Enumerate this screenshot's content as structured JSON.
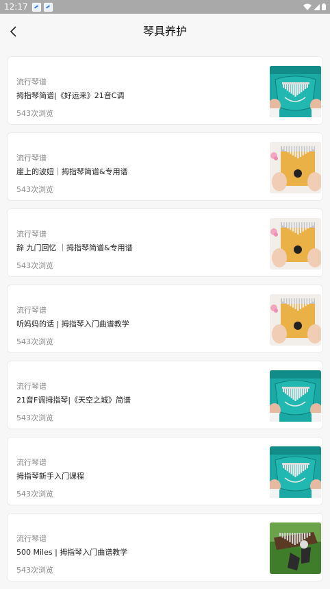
{
  "status_bar": {
    "time": "12:17"
  },
  "header": {
    "title": "琴具养护"
  },
  "items": [
    {
      "category": "流行琴谱",
      "title": "拇指琴简谱|《好运来》21音C调",
      "views": "543次浏览",
      "thumb_icon": "kalimba-teal-thumbnail"
    },
    {
      "category": "流行琴谱",
      "title": "崖上的波妞｜拇指琴简谱&专用谱",
      "views": "543次浏览",
      "thumb_icon": "kalimba-yellow-thumbnail"
    },
    {
      "category": "流行琴谱",
      "title": "辞 九门回忆 ｜拇指琴简谱&专用谱",
      "views": "543次浏览",
      "thumb_icon": "kalimba-yellow-thumbnail"
    },
    {
      "category": "流行琴谱",
      "title": "听妈妈的话 | 拇指琴入门曲谱教学",
      "views": "543次浏览",
      "thumb_icon": "kalimba-yellow-thumbnail"
    },
    {
      "category": "流行琴谱",
      "title": "21音F调拇指琴|《天空之城》简谱",
      "views": "543次浏览",
      "thumb_icon": "kalimba-teal-thumbnail"
    },
    {
      "category": "流行琴谱",
      "title": "拇指琴新手入门课程",
      "views": "543次浏览",
      "thumb_icon": "kalimba-teal-thumbnail"
    },
    {
      "category": "流行琴谱",
      "title": "500 Miles | 拇指琴入门曲谱教学",
      "views": "543次浏览",
      "thumb_icon": "kalimba-grass-thumbnail"
    }
  ]
}
